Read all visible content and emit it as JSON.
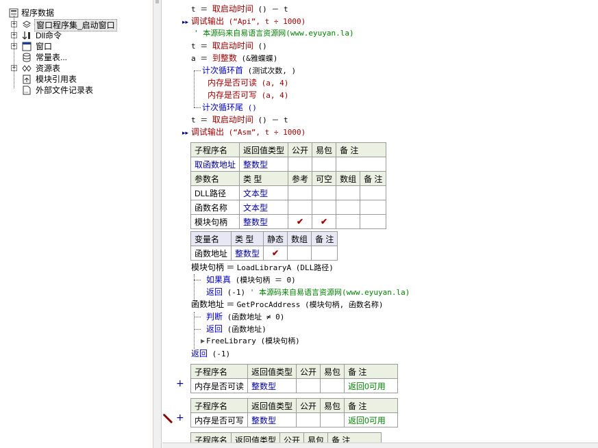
{
  "tree": {
    "root": "程序数据",
    "items": [
      {
        "label": "窗口程序集_启动窗口",
        "expander": "+",
        "icon": "assembly-icon"
      },
      {
        "label": "Dll命令",
        "expander": "+",
        "icon": "dll-command-icon"
      },
      {
        "label": "窗口",
        "expander": "+",
        "icon": "window-icon"
      },
      {
        "label": "常量表...",
        "expander": "",
        "icon": "constant-table-icon"
      },
      {
        "label": "资源表",
        "expander": "+",
        "icon": "resource-table-icon"
      },
      {
        "label": "模块引用表",
        "expander": "",
        "icon": "module-reference-icon"
      },
      {
        "label": "外部文件记录表",
        "expander": "",
        "icon": "external-file-icon"
      }
    ]
  },
  "code": {
    "line1": {
      "a": "t ＝ ",
      "b": "取启动时间",
      "c": " () － t"
    },
    "line2": {
      "a": "调试输出",
      "b": " (“Api”, t ÷ 1000)"
    },
    "line3": "' 本源码来自易语言资源网(www.eyuyan.la)",
    "line4": {
      "a": "t ＝ ",
      "b": "取启动时间",
      "c": " ()"
    },
    "line5": {
      "a": "a ＝ ",
      "b": "到整数",
      "c": " (&雅蝶蝶)"
    },
    "line6": {
      "a": "计次循环首",
      "b": " (测试次数, )"
    },
    "line7": {
      "a": "内存是否可读",
      "b": " (a, 4)"
    },
    "line8": {
      "a": "内存是否可写",
      "b": " (a, 4)"
    },
    "line9": {
      "a": "计次循环尾",
      "b": " ()"
    },
    "line10": {
      "a": "t ＝ ",
      "b": "取启动时间",
      "c": " () － t"
    },
    "line11": {
      "a": "调试输出",
      "b": " (“Asm”, t ÷ 1000)"
    },
    "line12": {
      "a": "模块句柄 ＝ ",
      "b": "LoadLibraryA (DLL路径)"
    },
    "line13": {
      "a": "如果真",
      "b": " (模块句柄 ＝ 0)"
    },
    "line14": {
      "a": "返回",
      "b": " (-1)  ",
      "c": "' 本源码来自易语言资源网(www.eyuyan.la)"
    },
    "line15": {
      "a": "函数地址 ＝ ",
      "b": "GetProcAddress (模块句柄, 函数名称)"
    },
    "line16": {
      "a": "判断",
      "b": " (函数地址 ≠ 0)"
    },
    "line17": {
      "a": "返回",
      "b": " (函数地址)"
    },
    "line18": {
      "a": "FreeLibrary (模块句柄)"
    },
    "line19": {
      "a": "返回",
      "b": " (-1)"
    }
  },
  "sub1": {
    "hdr": [
      "子程序名",
      "返回值类型",
      "公开",
      "易包",
      "备 注"
    ],
    "row": [
      "取函数地址",
      "整数型",
      "",
      "",
      ""
    ],
    "phdr": [
      "参数名",
      "类 型",
      "参考",
      "可空",
      "数组",
      "备 注"
    ],
    "params": [
      [
        "DLL路径",
        "文本型",
        "",
        "",
        "",
        ""
      ],
      [
        "函数名称",
        "文本型",
        "",
        "",
        "",
        ""
      ],
      [
        "模块句柄",
        "整数型",
        "✔",
        "✔",
        "",
        ""
      ]
    ]
  },
  "vars1": {
    "hdr": [
      "变量名",
      "类 型",
      "静态",
      "数组",
      "备 注"
    ],
    "row": [
      "函数地址",
      "整数型",
      "✔",
      "",
      ""
    ]
  },
  "sub2": {
    "hdr": [
      "子程序名",
      "返回值类型",
      "公开",
      "易包",
      "备 注"
    ],
    "row": [
      "内存是否可读",
      "整数型",
      "",
      "",
      "返回0可用"
    ]
  },
  "sub3": {
    "hdr": [
      "子程序名",
      "返回值类型",
      "公开",
      "易包",
      "备 注"
    ],
    "row": [
      "内存是否可写",
      "整数型",
      "",
      "",
      "返回0可用"
    ]
  },
  "sub4": {
    "hdr": [
      "子程序名",
      "返回值类型",
      "公开",
      "易包",
      "备 注"
    ]
  },
  "markers": {
    "plus": "+"
  },
  "colors": {
    "keyword": "#a00000",
    "command": "#0000c8",
    "comment": "#008000",
    "header_bg": "#eaf1e2"
  }
}
